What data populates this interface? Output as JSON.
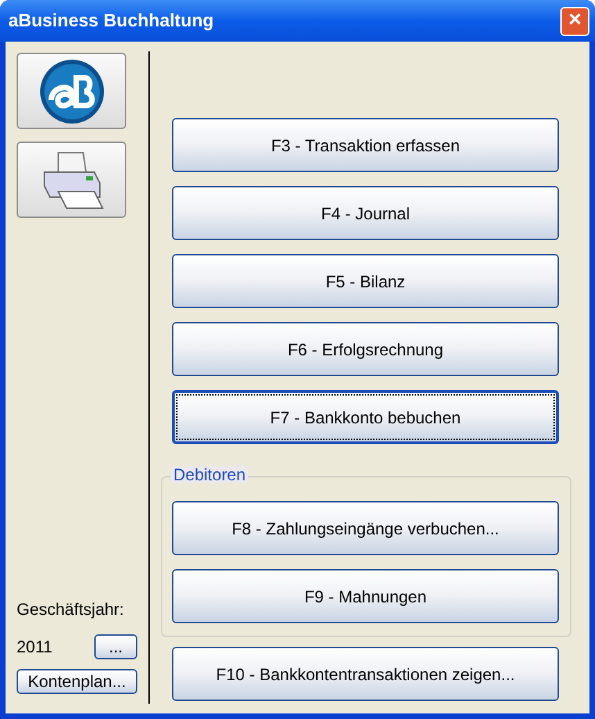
{
  "window": {
    "title": "aBusiness Buchhaltung",
    "close": "×"
  },
  "main_buttons": [
    {
      "label": "F3 - Transaktion erfassen",
      "focused": false
    },
    {
      "label": "F4 - Journal",
      "focused": false
    },
    {
      "label": "F5 - Bilanz",
      "focused": false
    },
    {
      "label": "F6 - Erfolgsrechnung",
      "focused": false
    },
    {
      "label": "F7 - Bankkonto bebuchen",
      "focused": true
    }
  ],
  "debitoren": {
    "legend": "Debitoren",
    "buttons": [
      {
        "label": "F8 - Zahlungseingänge verbuchen...",
        "focused": false
      },
      {
        "label": "F9 - Mahnungen",
        "focused": false
      }
    ]
  },
  "bottom_button": {
    "label": "F10 - Bankkontentransaktionen zeigen...",
    "focused": false
  },
  "sidebar": {
    "year_label": "Geschäftsjahr:",
    "year": "2011",
    "year_button": "...",
    "accounts_button": "Kontenplan..."
  }
}
